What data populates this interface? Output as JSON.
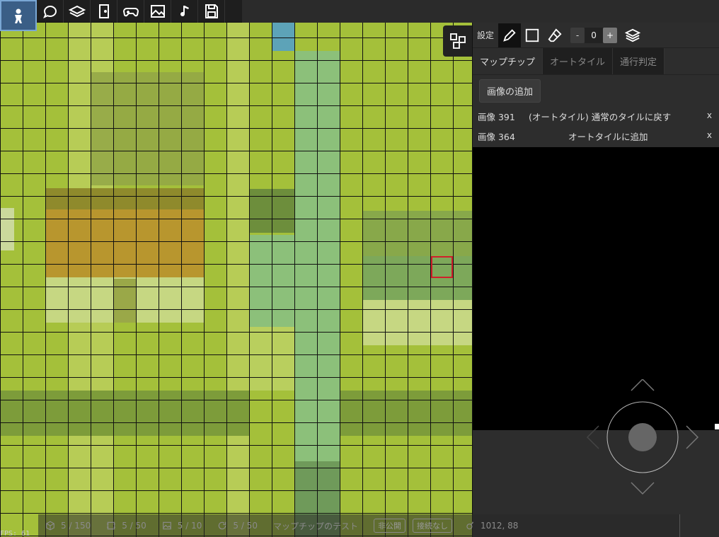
{
  "toolbar": {
    "buttons": [
      {
        "icon": "character-icon",
        "active": true
      },
      {
        "icon": "speech-bubble-icon"
      },
      {
        "icon": "layers-book-icon"
      },
      {
        "icon": "door-icon"
      },
      {
        "icon": "gamepad-icon"
      },
      {
        "icon": "image-icon"
      },
      {
        "icon": "music-note-icon"
      },
      {
        "icon": "save-icon"
      }
    ]
  },
  "panel": {
    "settings_label": "設定",
    "layer_value": "0",
    "minus_label": "-",
    "plus_label": "+",
    "tabs": [
      {
        "label": "マップチップ",
        "active": true
      },
      {
        "label": "オートタイル",
        "active": false
      },
      {
        "label": "通行判定",
        "active": false
      }
    ],
    "add_image_label": "画像の追加",
    "images": [
      {
        "name": "画像 391",
        "action": "(オートタイル) 通常のタイルに戻す",
        "remove": "x"
      },
      {
        "name": "画像 364",
        "action": "オートタイルに追加",
        "remove": "x"
      }
    ]
  },
  "status": {
    "objects": "5 / 150",
    "frames": "5 / 50",
    "images": "5 / 10",
    "scripts": "5 / 50",
    "map_name": "マップチップのテスト",
    "visibility": "非公開",
    "connection": "接続なし",
    "coords": "1012, 88",
    "fps": "FPS: 61"
  },
  "colors": {
    "cursor": "#d0202a",
    "toolbar_active": "#3a5e86",
    "grass": "#a4c03a",
    "path": "#8cc07a"
  }
}
